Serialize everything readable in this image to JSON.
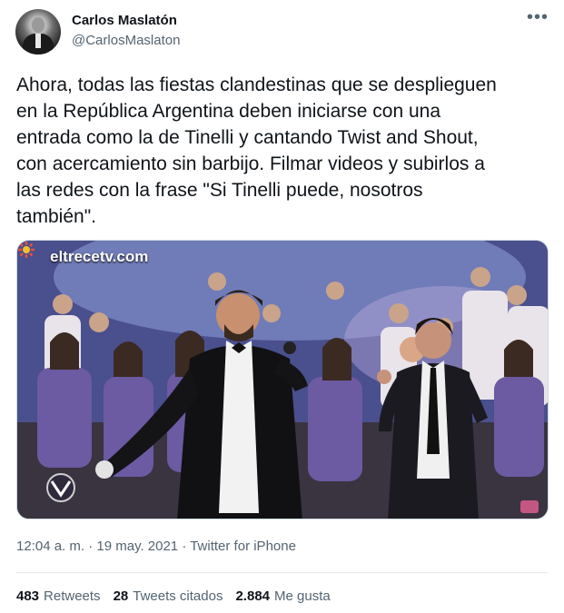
{
  "author": {
    "name": "Carlos Maslatón",
    "handle": "@CarlosMaslaton"
  },
  "tweet": {
    "text": "Ahora, todas las fiestas clandestinas que se desplieguen\nen la República Argentina deben iniciarse con una\nentrada como la de Tinelli y cantando Twist and Shout,\ncon acercamiento sin barbijo. Filmar videos y subirlos a\nlas redes con la frase \"Si Tinelli puede, nosotros\ntambién\".",
    "media_watermark": "eltrecetv.com",
    "timestamp": "12:04 a. m. · 19 may. 2021 · Twitter for iPhone"
  },
  "stats": {
    "retweets_count": "483",
    "retweets_label": "Retweets",
    "quotes_count": "28",
    "quotes_label": "Tweets citados",
    "likes_count": "2.884",
    "likes_label": "Me gusta"
  },
  "icons": {
    "more": "more-options-icon",
    "channel": "eltrece-logo-icon"
  }
}
